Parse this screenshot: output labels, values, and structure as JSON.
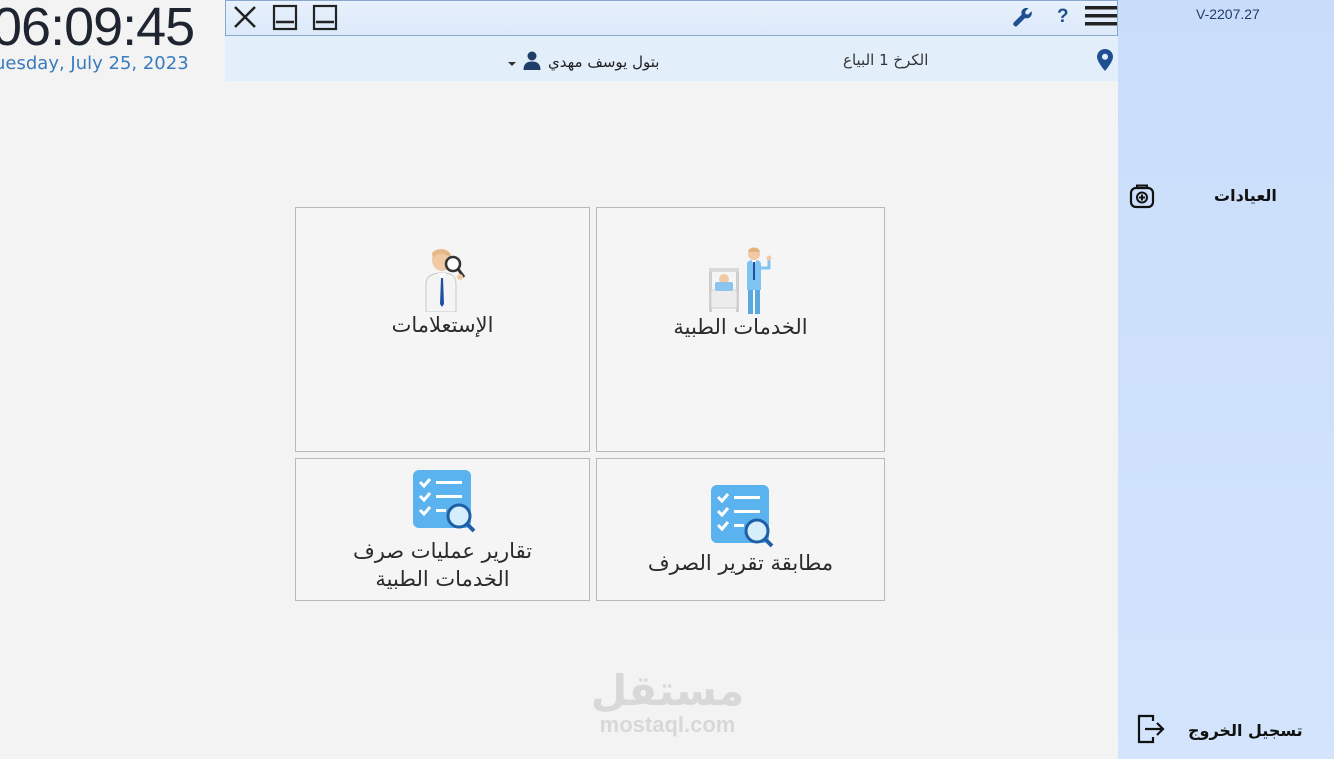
{
  "clock": {
    "time": "06:09:45",
    "date": "uesday, July 25, 2023"
  },
  "topbar": {
    "icons": [
      "close-icon",
      "minimize-icon",
      "restore-icon",
      "wrench-icon",
      "help-icon",
      "menu-icon"
    ],
    "help_label": "?"
  },
  "infobar": {
    "user_name": "بتول يوسف مهدي",
    "location": "الكرخ 1 البياع"
  },
  "sidebar": {
    "version": "V-2207.27",
    "clinics_label": "العيادات",
    "logout_label": "تسجيل الخروج"
  },
  "tiles": {
    "medical_services": "الخدمات الطبية",
    "inquiries": "الإستعلامات",
    "matching_report": "مطابقة تقرير الصرف",
    "dispensing_reports_line1": "تقارير عمليات صرف",
    "dispensing_reports_line2": "الخدمات الطبية"
  },
  "watermark": {
    "arabic": "مستقل",
    "latin": "mostaql.com"
  },
  "colors": {
    "accent": "#1f5fa8",
    "sidebar": "#cddffb",
    "date_text": "#3a7bbd"
  }
}
